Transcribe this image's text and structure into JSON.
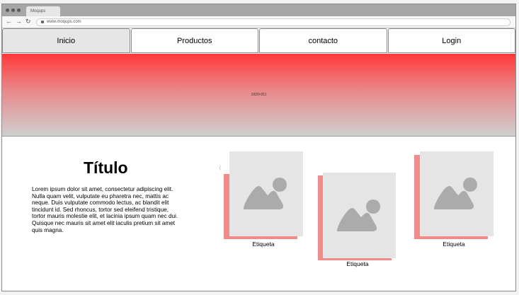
{
  "browser": {
    "tab_title": "Moqups",
    "url": "www.moqups.com",
    "back_glyph": "←",
    "forward_glyph": "→",
    "reload_glyph": "↻"
  },
  "nav": {
    "items": [
      {
        "label": "Inicio",
        "active": true
      },
      {
        "label": "Productos",
        "active": false
      },
      {
        "label": "contacto",
        "active": false
      },
      {
        "label": "Login",
        "active": false
      }
    ]
  },
  "hero": {
    "size_label": "1920×311",
    "colors": {
      "top": "#ff3838",
      "bottom": "#cfcfcf"
    }
  },
  "content": {
    "title": "Título",
    "body": "Lorem ipsum dolor sit amet, consectetur adipiscing elit. Nulla quam velit, vulputate eu pharetra nec, mattis ac neque. Duis vulputate commodo lectus, ac blandit elit tincidunt id. Sed rhoncus, tortor sed eleifend tristique, tortor mauris molestie elit, et lacinia ipsum quam nec dui. Quisque nec mauris sit amet elit iaculis pretium sit amet quis magna."
  },
  "gallery": {
    "cards": [
      {
        "caption": "Etiqueta",
        "icon": "image-placeholder-icon"
      },
      {
        "caption": "Etiqueta",
        "icon": "image-placeholder-icon"
      },
      {
        "caption": "Etiqueta",
        "icon": "image-placeholder-icon"
      }
    ],
    "accent_color": "#f28a8a",
    "stray_mark": "("
  }
}
